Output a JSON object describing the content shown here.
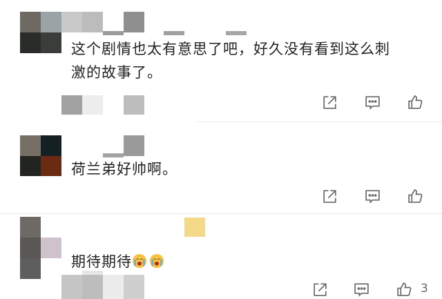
{
  "colors": {
    "text": "#222222",
    "icon": "#666666",
    "divider": "#e6e6e6",
    "emoji_face": "#f6c343"
  },
  "comments": [
    {
      "lines": [
        "这个剧情也太有意思了吧，好久没有看到这么刺",
        "激的故事了。"
      ],
      "actions": {
        "share_icon": "share-icon",
        "reply_icon": "comment-icon",
        "like_icon": "thumbs-up-icon"
      }
    },
    {
      "lines": [
        "荷兰弟好帅啊。"
      ],
      "actions": {
        "share_icon": "share-icon",
        "reply_icon": "comment-icon",
        "like_icon": "thumbs-up-icon"
      }
    },
    {
      "lines": [
        "期待期待"
      ],
      "emojis": [
        "crying-face-emoji",
        "crying-face-emoji"
      ],
      "actions": {
        "share_icon": "share-icon",
        "reply_icon": "comment-icon",
        "like_icon": "thumbs-up-icon"
      },
      "like_count": "3"
    }
  ]
}
